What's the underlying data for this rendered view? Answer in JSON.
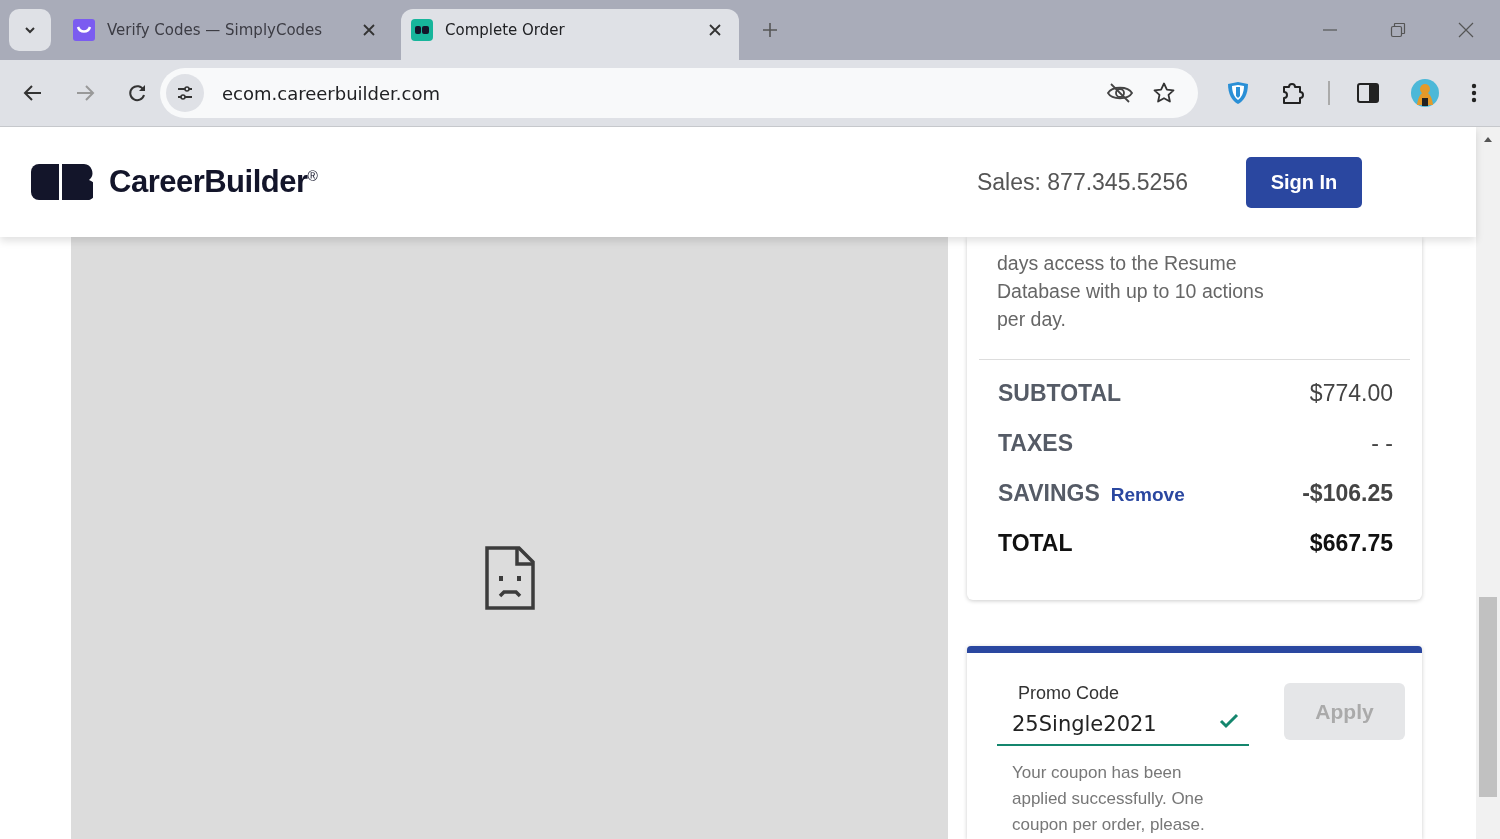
{
  "browser": {
    "tabs": [
      {
        "title": "Verify Codes — SimplyCodes",
        "selected": false
      },
      {
        "title": "Complete Order",
        "selected": true
      }
    ],
    "url": "ecom.careerbuilder.com"
  },
  "header": {
    "brand": "CareerBuilder$^{®}$",
    "sales": "Sales: 877.345.5256",
    "sign_in": "Sign In"
  },
  "order_summary": {
    "description": "days access to the Resume Database with up to 10 actions per day.",
    "rows": [
      {
        "kind": "plain",
        "label": "SUBTOTAL",
        "value": "$774.00"
      },
      {
        "kind": "plain",
        "label": "TAXES",
        "value": "- -"
      },
      {
        "kind": "savings",
        "label": "SAVINGS",
        "link": "Remove",
        "value": "-$106.25"
      },
      {
        "kind": "total",
        "label": "TOTAL",
        "value": "$667.75"
      }
    ]
  },
  "promo": {
    "label": "Promo Code",
    "value": "25Single2021",
    "valid": true,
    "apply": "Apply",
    "apply_disabled": true,
    "message": "Your coupon has been applied successfully. One coupon per order, please."
  }
}
